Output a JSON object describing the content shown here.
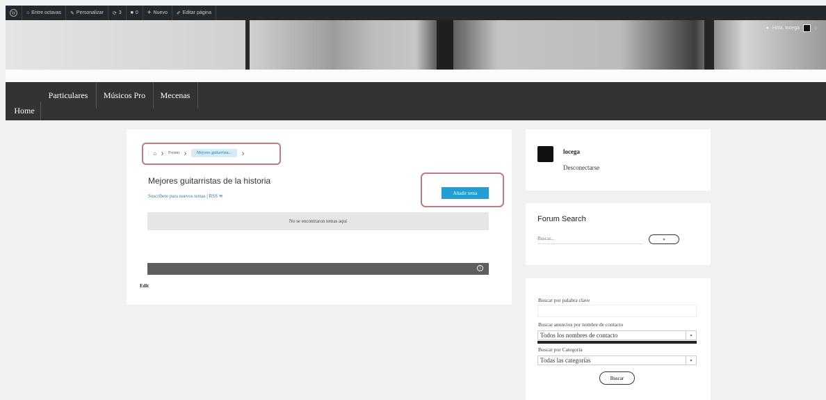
{
  "adminbar": {
    "site_name": "Entre octavas",
    "customize": "Personalizar",
    "updates_count": "3",
    "comments_count": "0",
    "new": "Nuevo",
    "edit_page": "Editar página",
    "greeting": "Hola, locega"
  },
  "nav": {
    "home": "Home",
    "items": [
      "Particulares",
      "Músicos Pro",
      "Mecenas"
    ]
  },
  "forum": {
    "breadcrumb": [
      "Forum",
      "Mejores guitarrista..."
    ],
    "title": "Mejores guitarristas de la historia",
    "subscribe": "Suscríbete para nuevos temas",
    "rss": "RSS",
    "add_topic": "Añadir tema",
    "no_topics": "No se encontraron temas aquí",
    "edit": "Edit"
  },
  "sidebar": {
    "user": {
      "name": "locega",
      "logout": "Desconectarse"
    },
    "forum_search": {
      "title": "Forum Search",
      "placeholder": "Buscar...",
      "button": "»"
    },
    "classifieds": {
      "keyword_label": "Buscar por palabra clave",
      "contact_label": "Buscar anuncios por nombre de contacto",
      "contact_value": "Todos los nombres de contacto",
      "category_label": "Buscar por Categoría",
      "category_value": "Todas las categorías",
      "search_button": "Buscar"
    }
  },
  "colors": {
    "accent": "#1ea0d6",
    "highlight": "#c4797e",
    "nav_bg": "#333333"
  }
}
